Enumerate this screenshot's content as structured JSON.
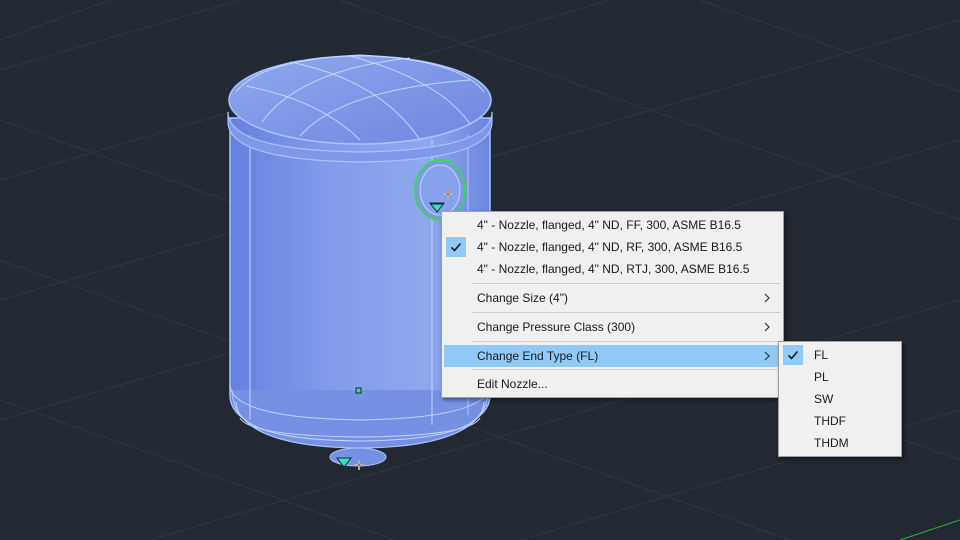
{
  "colors": {
    "background": "#222933",
    "vessel": "#7b97e8",
    "highlight": "#91c9f7",
    "menu_bg": "#f0f0f0"
  },
  "context_menu": {
    "nozzle_options": [
      {
        "label": "4\" - Nozzle, flanged, 4\" ND, FF, 300, ASME B16.5",
        "checked": false
      },
      {
        "label": "4\" - Nozzle, flanged, 4\" ND, RF, 300, ASME B16.5",
        "checked": true
      },
      {
        "label": "4\" - Nozzle, flanged, 4\" ND, RTJ, 300, ASME B16.5",
        "checked": false
      }
    ],
    "change_size": "Change Size (4\")",
    "change_pressure_class": "Change Pressure Class (300)",
    "change_end_type": "Change End Type (FL)",
    "edit_nozzle": "Edit Nozzle..."
  },
  "end_type_submenu": {
    "options": [
      "FL",
      "PL",
      "SW",
      "THDF",
      "THDM"
    ],
    "selected": "FL"
  },
  "icons": [
    "checkmark-icon",
    "chevron-right-icon",
    "grip-icon",
    "flow-arrow-icon"
  ]
}
